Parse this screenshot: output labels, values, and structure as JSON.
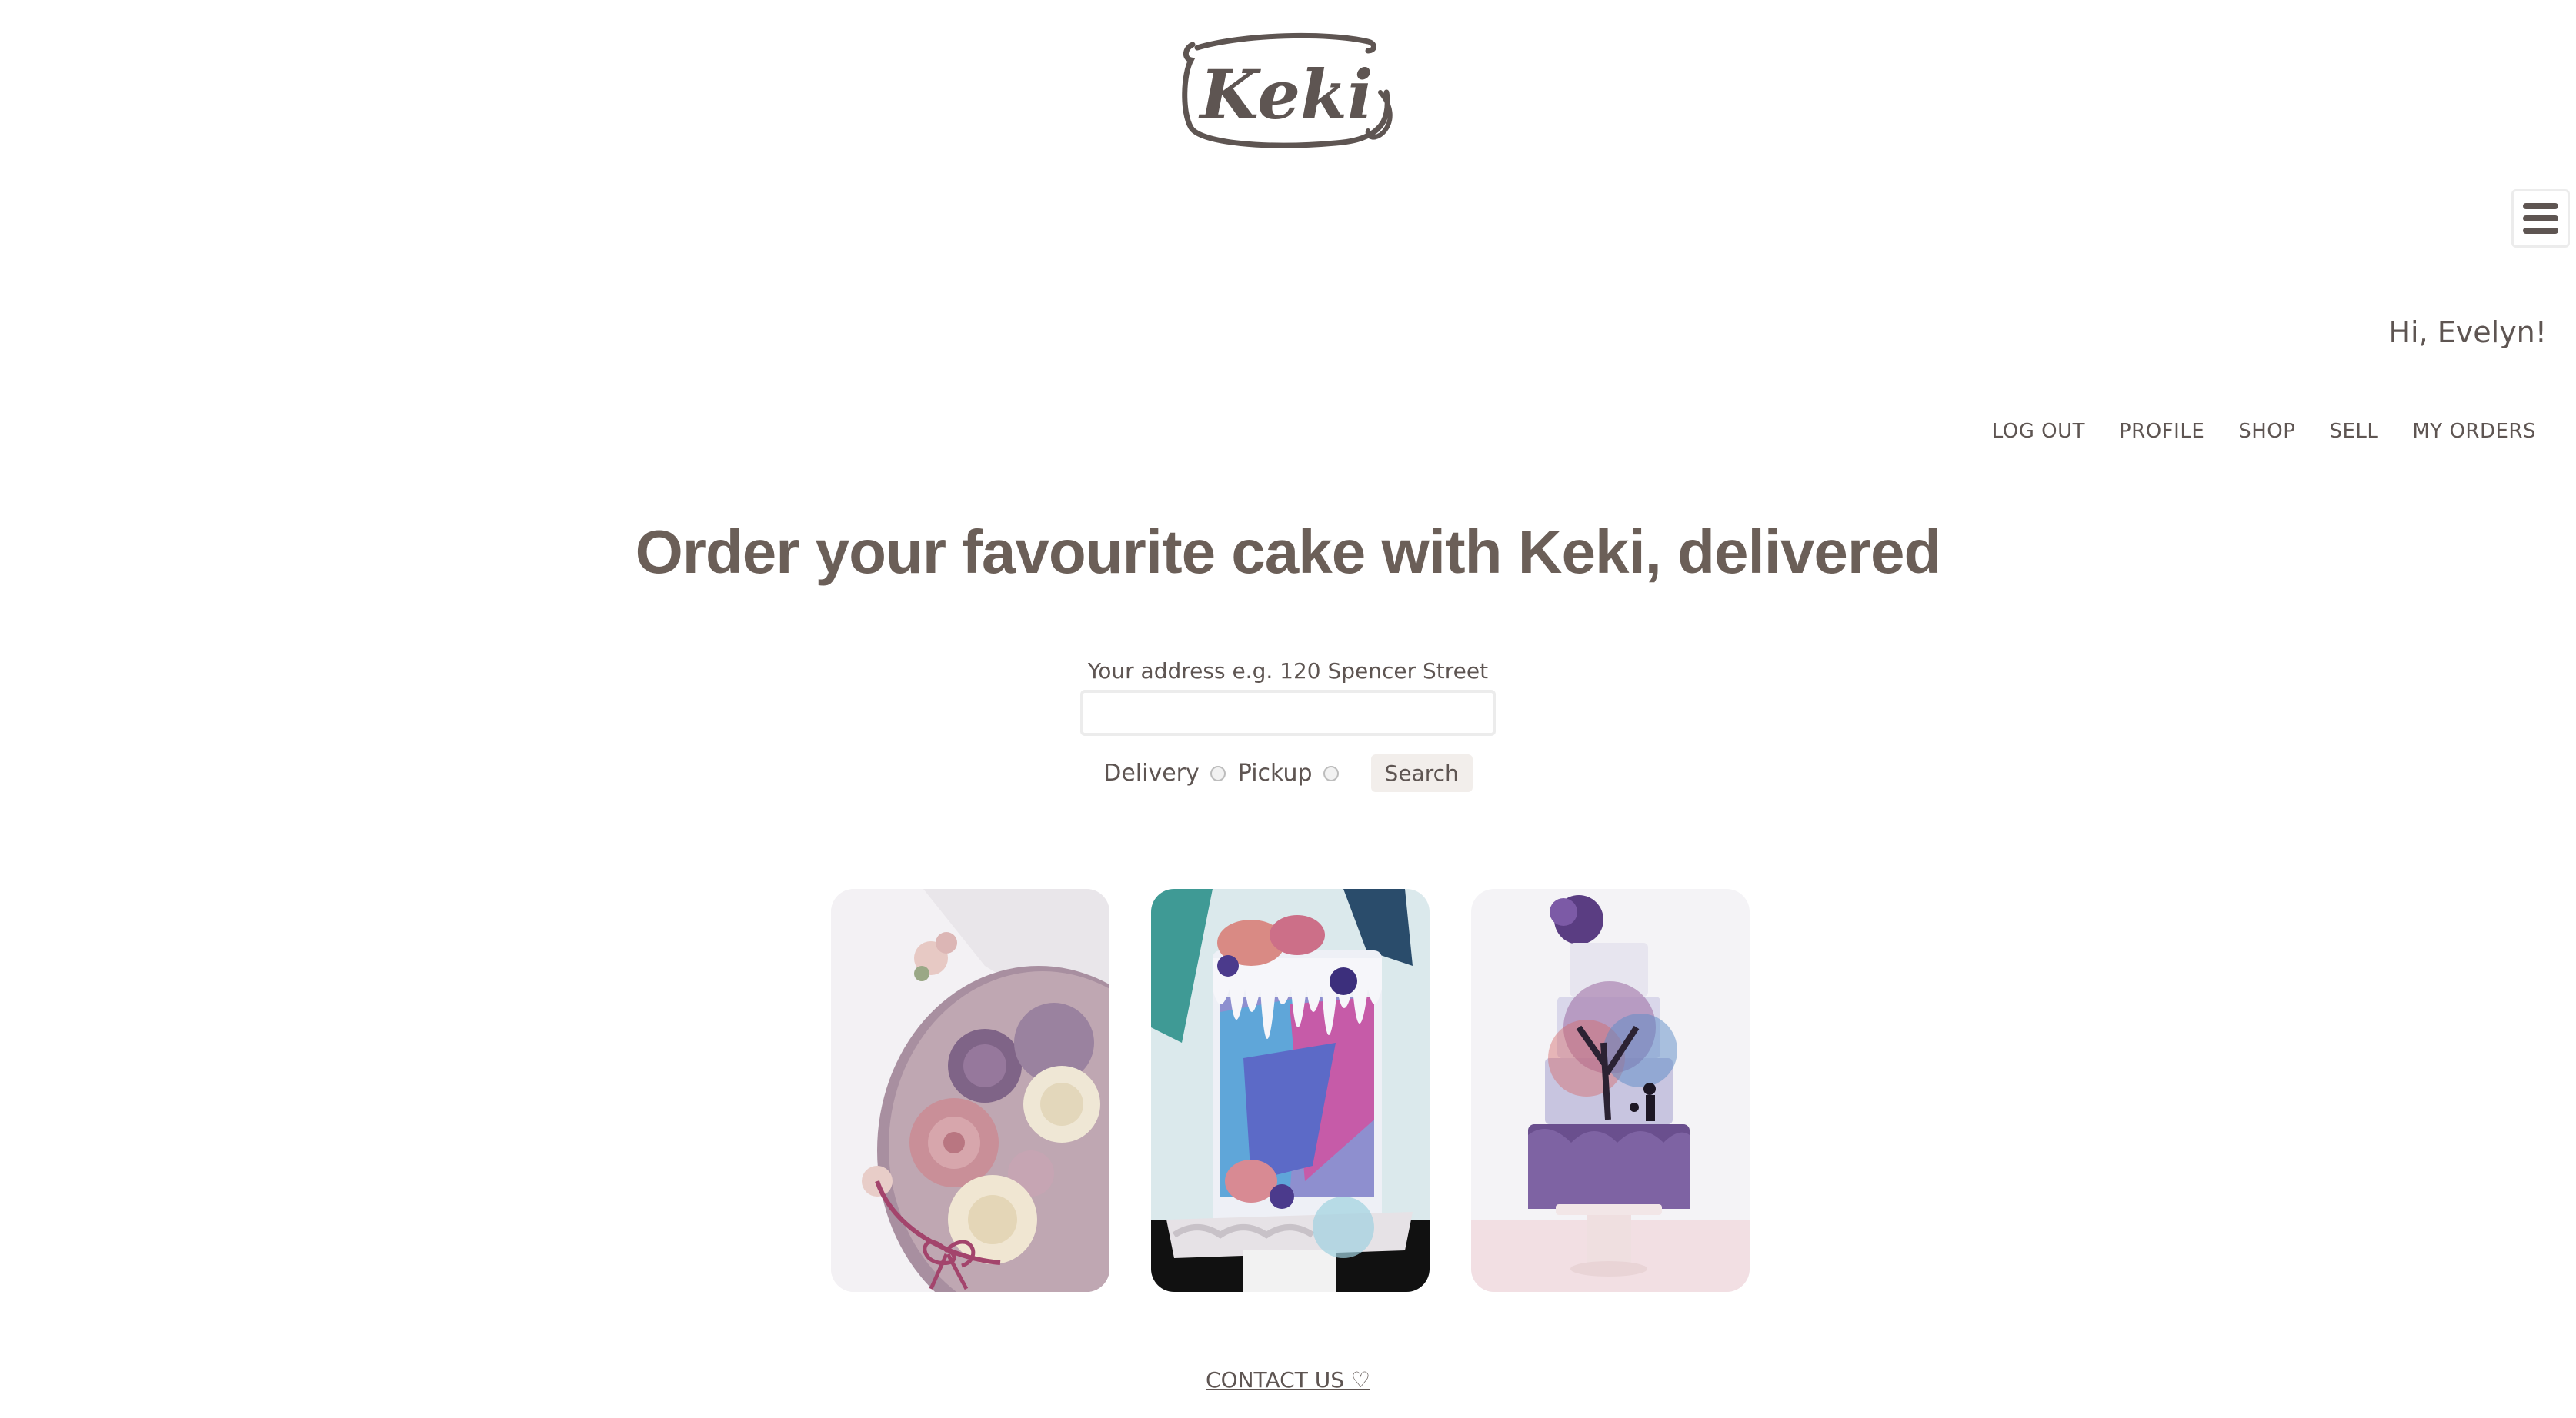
{
  "brand": {
    "logo_text": "Keki",
    "text_color": "#5e5552"
  },
  "header": {
    "menu_icon": "hamburger-menu-icon",
    "greeting": "Hi, Evelyn!"
  },
  "nav": {
    "items": [
      {
        "label": "LOG OUT"
      },
      {
        "label": "PROFILE"
      },
      {
        "label": "SHOP"
      },
      {
        "label": "SELL"
      },
      {
        "label": "MY ORDERS"
      }
    ]
  },
  "hero": {
    "title": "Order your favourite cake with Keki, delivered"
  },
  "search": {
    "address_label": "Your address e.g. 120 Spencer Street",
    "address_value": "",
    "options": [
      {
        "label": "Delivery",
        "checked": false
      },
      {
        "label": "Pickup",
        "checked": false
      }
    ],
    "button_label": "Search"
  },
  "gallery": {
    "cakes": [
      {
        "description_icon": "floral-buttercream-cake-image"
      },
      {
        "description_icon": "drip-cake-with-macarons-image"
      },
      {
        "description_icon": "tiered-painted-tree-cake-image"
      }
    ]
  },
  "footer": {
    "contact_label": "CONTACT US ♡"
  }
}
